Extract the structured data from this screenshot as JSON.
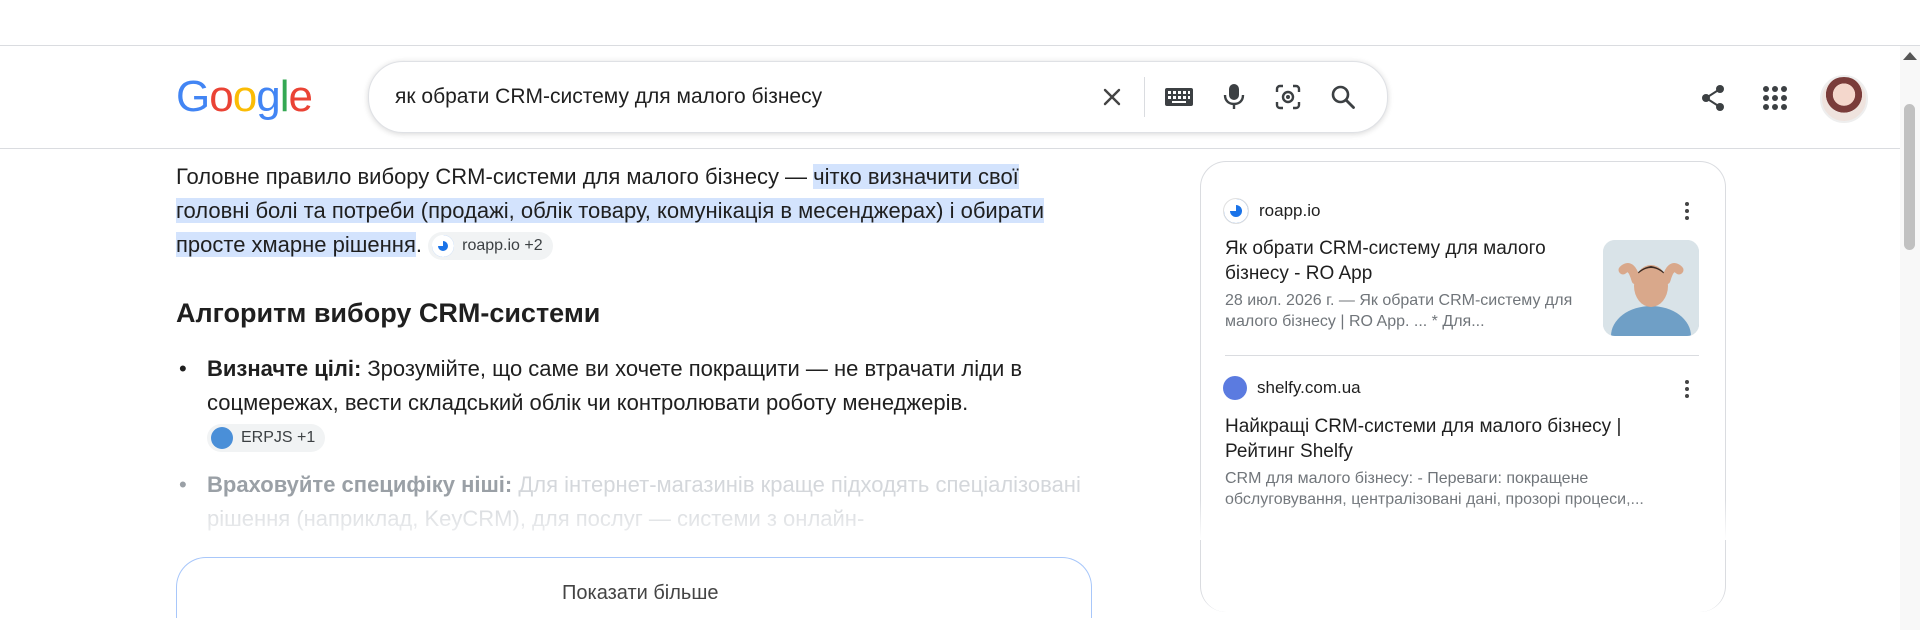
{
  "logo": {
    "text_parts": [
      "G",
      "o",
      "o",
      "g",
      "l",
      "e"
    ]
  },
  "search": {
    "query": "як обрати CRM-систему для малого бізнесу",
    "icons": [
      "close-icon",
      "keyboard-icon",
      "microphone-icon",
      "lens-icon",
      "search-icon"
    ]
  },
  "header_icons": [
    "share-icon",
    "apps-grid-icon",
    "avatar"
  ],
  "answer": {
    "intro_plain": "Головне правило вибору CRM-системи для малого бізнесу — ",
    "intro_highlight": "чітко визначити свої головні болі та потреби (продажі, облік товару, комунікація в месенджерах) і обирати просте хмарне рішення",
    "intro_end": ".",
    "intro_chip": "roapp.io +2"
  },
  "section_title": "Алгоритм вибору CRM-системи",
  "list": [
    {
      "bullet": "•",
      "bold": "Визначте цілі:",
      "text": " Зрозумійте, що саме ви хочете покращити — не втрачати ліди в соцмережах, вести складський облік чи контролювати роботу менеджерів.",
      "chip": "ERPJS +1"
    },
    {
      "bullet": "•",
      "bold": "Враховуйте специфіку ніші:",
      "text": " Для інтернет-магазинів краще підходять спеціалізовані рішення (наприклад, KeyCRM), для послуг — системи з онлайн-"
    }
  ],
  "show_more": "Показати більше",
  "sources": [
    {
      "site": "roapp.io",
      "title": "Як обрати CRM-систему для малого бізнесу - RO App",
      "snippet": "28 июл. 2026 г. — Як обрати CRM-систему для малого бізнесу | RO App. ... * Для...",
      "fav_color": "#1a73e8"
    },
    {
      "site": "shelfy.com.ua",
      "title": "Найкращі CRM-системи для малого бізнесу | Рейтинг Shelfy",
      "snippet": "CRM для малого бізнесу: - Переваги: покращене обслуговування, централізовані дані, прозорі процеси,...",
      "fav_color": "#5b7be0"
    }
  ]
}
